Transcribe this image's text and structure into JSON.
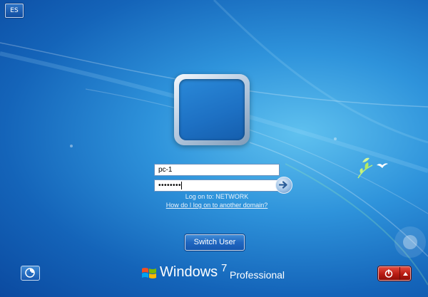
{
  "language_indicator": "ES",
  "login": {
    "username_value": "pc-1",
    "password_mask": "••••••••",
    "logon_to": "Log on to: NETWORK",
    "domain_help_link": "How do I log on to another domain?",
    "submit_icon": "arrow-right-icon"
  },
  "switch_user_label": "Switch User",
  "brand": {
    "name": "Windows",
    "version": "7",
    "edition": "Professional"
  },
  "icons": {
    "ease_of_access": "ease-of-access-icon",
    "power": "power-icon",
    "power_options": "caret-up-icon",
    "logo": "windows-flag-icon"
  },
  "colors": {
    "background": "#1f7ccd",
    "power_button": "#b81b13",
    "button_blue": "#1f66c0"
  }
}
